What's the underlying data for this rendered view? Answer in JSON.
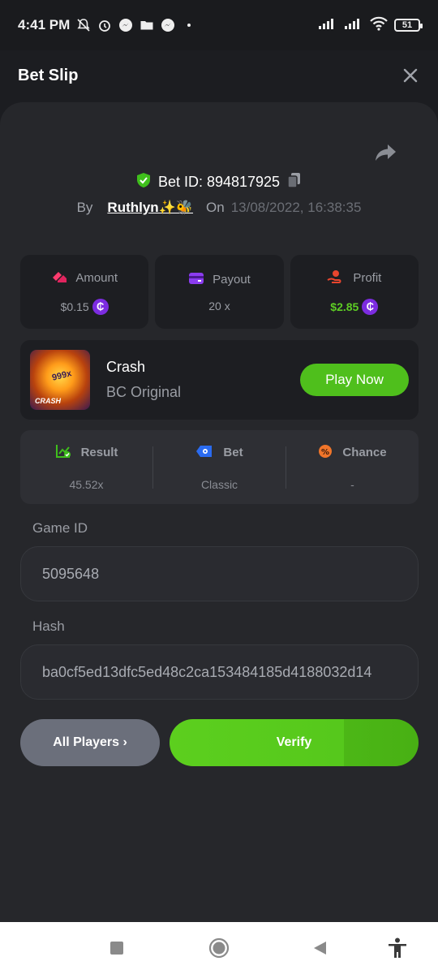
{
  "status_bar": {
    "time": "4:41 PM",
    "battery": "51"
  },
  "header": {
    "title": "Bet Slip"
  },
  "bet": {
    "id_label": "Bet ID: 894817925",
    "by_label": "By",
    "user": "Ruthlyn✨🐝",
    "on_label": "On",
    "date": "13/08/2022, 16:38:35"
  },
  "stats": [
    {
      "label": "Amount",
      "value": "$0.15"
    },
    {
      "label": "Payout",
      "value": "20 x"
    },
    {
      "label": "Profit",
      "value": "$2.85"
    }
  ],
  "game": {
    "thumb_text": "999x",
    "thumb_caption": "CRASH",
    "name": "Crash",
    "subtitle": "BC Original",
    "play_label": "Play Now"
  },
  "result": [
    {
      "label": "Result",
      "value": "45.52x"
    },
    {
      "label": "Bet",
      "value": "Classic"
    },
    {
      "label": "Chance",
      "value": "-"
    }
  ],
  "game_id": {
    "label": "Game ID",
    "value": "5095648"
  },
  "hash": {
    "label": "Hash",
    "value": "ba0cf5ed13dfc5ed48c2ca153484185d4188032d14"
  },
  "buttons": {
    "all_players": "All Players ›",
    "verify": "Verify"
  },
  "colors": {
    "accent_green": "#4fbf1c",
    "coin_purple": "#7c2ce0",
    "profit_green": "#5dcc24"
  },
  "icons": [
    "bell-off-icon",
    "alarm-icon",
    "messenger-icon",
    "folder-icon",
    "signal-icon",
    "wifi-icon",
    "close-icon",
    "share-icon",
    "shield-check-icon",
    "copy-icon",
    "amount-icon",
    "payout-icon",
    "profit-icon",
    "result-icon",
    "bet-icon",
    "chance-icon",
    "nav-recents-icon",
    "nav-home-icon",
    "nav-back-icon",
    "accessibility-icon"
  ]
}
